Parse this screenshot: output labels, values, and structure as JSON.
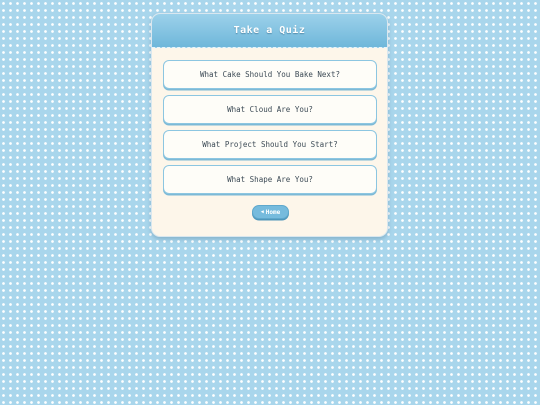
{
  "header": {
    "title": "Take a Quiz"
  },
  "quizzes": [
    {
      "label": "What Cake Should You Bake Next?"
    },
    {
      "label": "What Cloud Are You?"
    },
    {
      "label": "What Project Should You Start?"
    },
    {
      "label": "What Shape Are You?"
    }
  ],
  "home_button": {
    "icon": "back-arrow-icon",
    "label": "Home"
  },
  "colors": {
    "background": "#a9d6ec",
    "header_accent": "#6fb7da",
    "card_background": "#fdf6ea",
    "button_border": "#8cc6e1"
  }
}
